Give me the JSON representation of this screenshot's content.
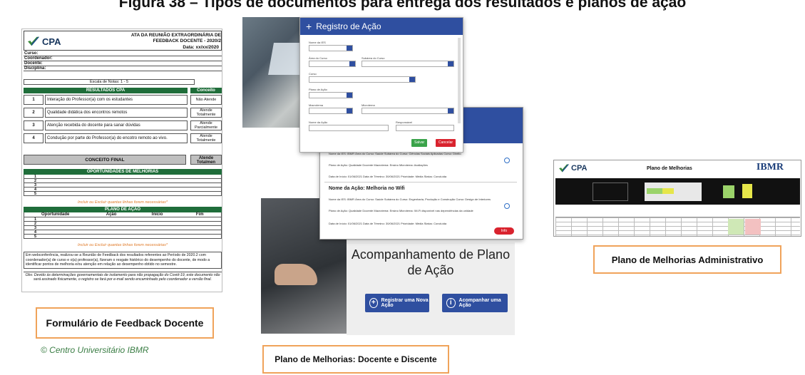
{
  "figure": {
    "title": "Figura 38 – Tipos de documentos para entrega dos resultados e planos de ação"
  },
  "form": {
    "logo": "CPA",
    "header_title": "ATA DA REUNIÃO EXTRAORDINÁRIA DE FEEDBACK DOCENTE - 2020/2",
    "date": "Data: xx/xx/2020",
    "fields": [
      "Curso:",
      "Coordenador:",
      "Docente:",
      "Disciplina:"
    ],
    "scale": "Escala de Notas: 1 - 5",
    "results_header": "RESULTADOS CPA",
    "concept_header": "Conceito",
    "questions": [
      {
        "num": "1",
        "text": "Interação do Professor(a) com os estudantes",
        "value": "Não Atende"
      },
      {
        "num": "2",
        "text": "Qualidade didática dos encontros remotos",
        "value": "Atende Totalmente"
      },
      {
        "num": "3",
        "text": "Atenção recebida do docente para sanar dúvidas",
        "value": "Atende Parcialmente"
      },
      {
        "num": "4",
        "text": "Condução por parte do Professor(a) do encotro remoto ao vivo.",
        "value": "Atende Totalmente"
      }
    ],
    "final_concept_label": "CONCEITO FINAL",
    "final_concept_value": "Atende Totalmen",
    "opportunities_header": "OPORTUNIDADES DE MELHORIAS",
    "opportunity_rows": [
      "1",
      "2",
      "3",
      "4",
      "5"
    ],
    "insert_note": "Incluir ou Excluir quantas linhas forem necessárias*",
    "action_plan_header": "PLANO DE AÇÃO",
    "action_plan_columns": [
      "Oportunidade",
      "Ação",
      "Início",
      "Fim"
    ],
    "action_rows": [
      "1",
      "2",
      "3",
      "4",
      "5"
    ],
    "insert_note_2": "Incluir ou Excluir quantas linhas forem necessárias*",
    "paragraph": "Em webconferência, realizou-se a Reunião de Feedback dos resultados referentes ao Período de 2020.2 com coordenador(a) de curso e o(a) professor(a), fizeram o resgate histórico do desempenho do docente, de modo a identificar pontos de melhoria e/ou atenção em relação ao desempenho obtido no semestre.",
    "obs": "Obs: Devido às determinações governamentais de isolamento para não propagação do Covid-19, este documento não será assinado fisicamente, o registro se fará por e-mail sendo encaminhado pelo coordenador a versão final."
  },
  "captions": {
    "form": "Formulário de Feedback Docente",
    "docente_discente": "Plano de Melhorias: Docente e Discente",
    "administrativo": "Plano de Melhorias Administrativo"
  },
  "copyright": "© Centro Universitário IBMR",
  "registro": {
    "title": "Registro de Ação",
    "labels": [
      "Nome da IES",
      "Área do Curso",
      "Subárea do Curso",
      "Curso",
      "Plano de Ação",
      "Macrotema",
      "Microtema",
      "Nome da Ação",
      "Responsável"
    ],
    "save_label": "Salvar",
    "cancel_label": "Cancelar"
  },
  "search": {
    "row1": "Nome da IES: IBMR    Área do Curso: Saúde    Subárea do Curso: Ciências Sociais Aplicadas    Curso: Direito",
    "row1b": "Plano de Ação: Qualidade Docente    Macrotema: Ensino    Microtema: Avaliações",
    "row1c": "Data de Início: 01/06/2021    Data de Término: 30/06/2021    Prioridade: Média    Status: Concluída",
    "title2": "Nome da Ação: Melhoria no Wifi",
    "row2": "Nome da IES: IBMR    Área do Curso: Saúde    Subárea do Curso: Engenharia, Produção e Construção    Curso: Design de Interiores",
    "row2b": "Plano de Ação: Qualidade Docente    Macrotema: Ensino    Microtema: Wi-Fi disponível nas dependências da unidade",
    "row2c": "Data de Início: 01/06/2021    Data de Término: 30/06/2021    Prioridade: Média    Status: Concluída",
    "info_label": "Info"
  },
  "acompanhamento": {
    "title": "Acompanhamento de Plano de Ação",
    "register_label": "Registrar uma Nova Ação",
    "follow_label": "Acompanhar uma Ação"
  },
  "sheet": {
    "logo": "CPA",
    "title": "Plano de Melhorias",
    "brand": "IBMR"
  },
  "colors": {
    "form_green": "#1f6d3a",
    "app_blue": "#2f4fa0",
    "caption_border": "#f0a35a",
    "note_orange": "#e07b2a",
    "copyright_green": "#3a7d44"
  }
}
